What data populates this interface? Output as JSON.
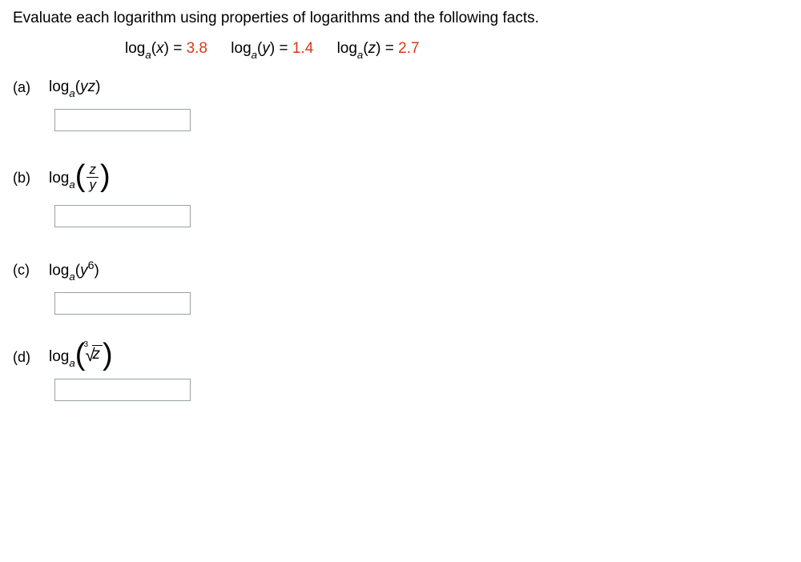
{
  "instruction": "Evaluate each logarithm using properties of logarithms and the following facts.",
  "facts": {
    "fx": {
      "func": "log",
      "base": "a",
      "arg": "x",
      "eq": " = ",
      "val": "3.8"
    },
    "fy": {
      "func": "log",
      "base": "a",
      "arg": "y",
      "eq": " = ",
      "val": "1.4"
    },
    "fz": {
      "func": "log",
      "base": "a",
      "arg": "z",
      "eq": " = ",
      "val": "2.7"
    }
  },
  "problems": {
    "a": {
      "label": "(a)",
      "func": "log",
      "base": "a",
      "arg_open": "(",
      "arg": "yz",
      "arg_close": ")"
    },
    "b": {
      "label": "(b)",
      "func": "log",
      "base": "a",
      "num": "z",
      "den": "y"
    },
    "c": {
      "label": "(c)",
      "func": "log",
      "base": "a",
      "arg_open": "(",
      "argbase": "y",
      "exp": "6",
      "arg_close": ")"
    },
    "d": {
      "label": "(d)",
      "func": "log",
      "base": "a",
      "root_index": "3",
      "radicand": "z"
    }
  }
}
